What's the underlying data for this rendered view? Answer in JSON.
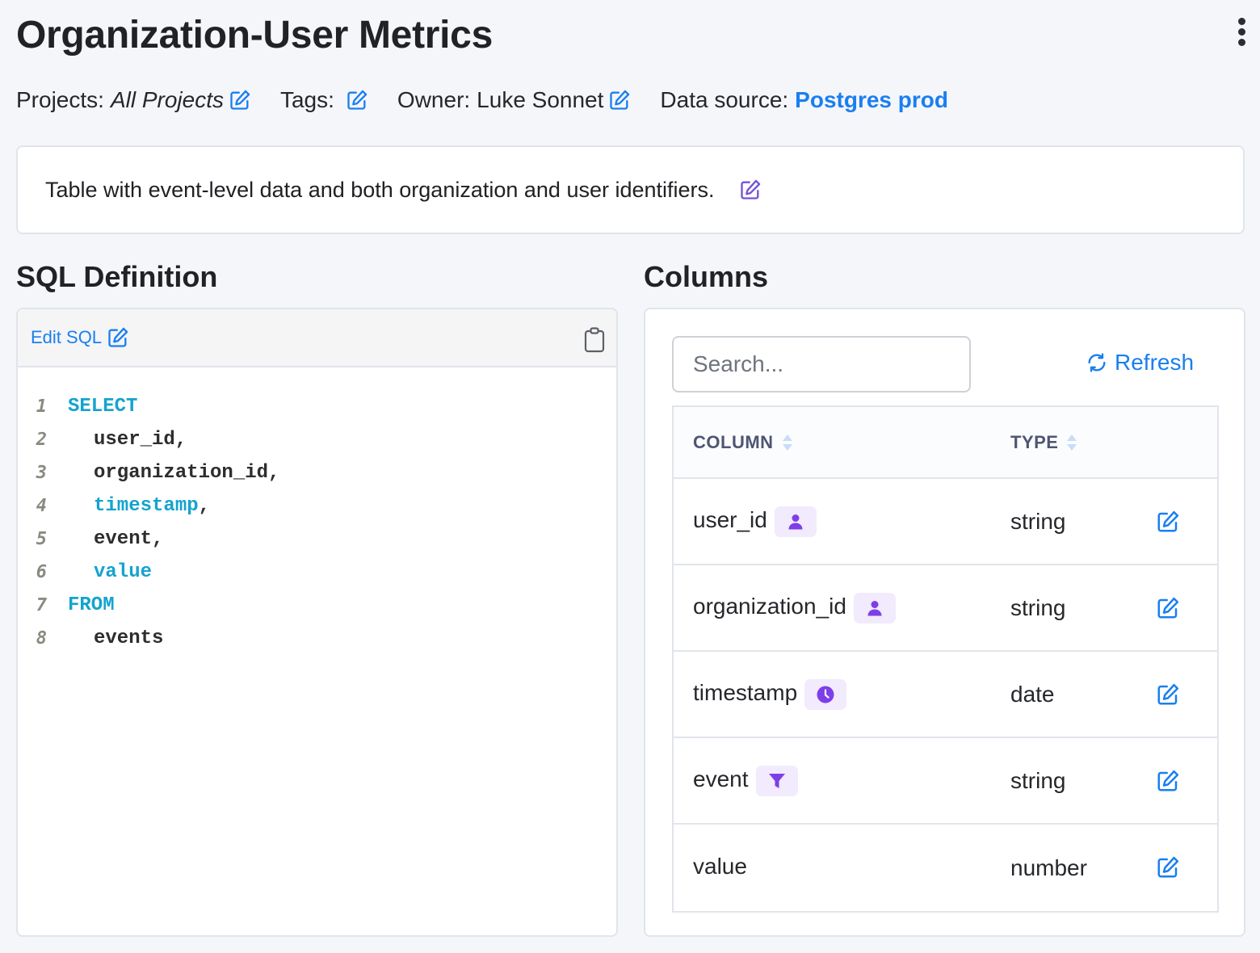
{
  "page": {
    "title": "Organization-User Metrics",
    "menu_icon": "more-vertical-icon"
  },
  "meta": {
    "projects_label": "Projects:",
    "projects_value": "All Projects",
    "tags_label": "Tags:",
    "owner_label": "Owner:",
    "owner_value": "Luke Sonnet",
    "data_source_label": "Data source:",
    "data_source_value": "Postgres prod"
  },
  "description": {
    "text": "Table with event-level data and both organization and user identifiers."
  },
  "sql": {
    "heading": "SQL Definition",
    "edit_label": "Edit SQL",
    "copy_icon": "clipboard-icon",
    "lines": [
      {
        "n": "1",
        "text": "SELECT",
        "kind": "keyword",
        "indent": 0
      },
      {
        "n": "2",
        "text": "user_id,",
        "kind": "plain",
        "indent": 1
      },
      {
        "n": "3",
        "text": "organization_id,",
        "kind": "plain",
        "indent": 1
      },
      {
        "n": "4",
        "text": "timestamp",
        "suffix": ",",
        "kind": "keyword",
        "indent": 1
      },
      {
        "n": "5",
        "text": "event,",
        "kind": "plain",
        "indent": 1
      },
      {
        "n": "6",
        "text": "value",
        "kind": "keyword",
        "indent": 1
      },
      {
        "n": "7",
        "text": "FROM",
        "kind": "keyword",
        "indent": 0
      },
      {
        "n": "8",
        "text": "events",
        "kind": "plain",
        "indent": 1
      }
    ]
  },
  "columns": {
    "heading": "Columns",
    "search_placeholder": "Search...",
    "search_value": "",
    "refresh_label": "Refresh",
    "headers": {
      "column": "COLUMN",
      "type": "TYPE"
    },
    "rows": [
      {
        "name": "user_id",
        "type": "string",
        "badge": "user-icon"
      },
      {
        "name": "organization_id",
        "type": "string",
        "badge": "user-icon"
      },
      {
        "name": "timestamp",
        "type": "date",
        "badge": "clock-icon"
      },
      {
        "name": "event",
        "type": "string",
        "badge": "filter-icon"
      },
      {
        "name": "value",
        "type": "number",
        "badge": null
      }
    ]
  },
  "colors": {
    "accent_blue": "#1a7ff0",
    "badge_purple": "#7e3ee8",
    "badge_bg": "#f1ebfd",
    "sql_keyword": "#14a3cf",
    "description_edit_purple": "#7552d6"
  }
}
